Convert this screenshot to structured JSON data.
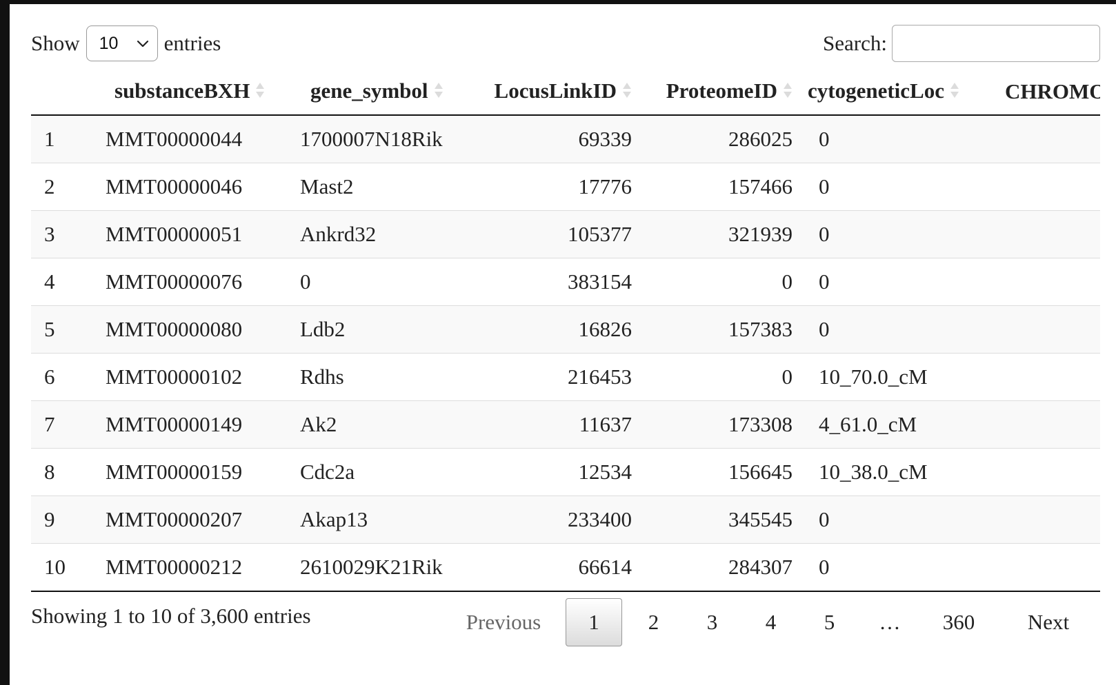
{
  "controls": {
    "show_label": "Show",
    "entries_label": "entries",
    "page_length_value": "10",
    "search_label": "Search:",
    "search_value": ""
  },
  "table": {
    "columns": [
      "",
      "substanceBXH",
      "gene_symbol",
      "LocusLinkID",
      "ProteomeID",
      "cytogeneticLoc",
      "CHROMO"
    ],
    "rows": [
      [
        "1",
        "MMT00000044",
        "1700007N18Rik",
        "69339",
        "286025",
        "0"
      ],
      [
        "2",
        "MMT00000046",
        "Mast2",
        "17776",
        "157466",
        "0"
      ],
      [
        "3",
        "MMT00000051",
        "Ankrd32",
        "105377",
        "321939",
        "0"
      ],
      [
        "4",
        "MMT00000076",
        "0",
        "383154",
        "0",
        "0"
      ],
      [
        "5",
        "MMT00000080",
        "Ldb2",
        "16826",
        "157383",
        "0"
      ],
      [
        "6",
        "MMT00000102",
        "Rdhs",
        "216453",
        "0",
        "10_70.0_cM"
      ],
      [
        "7",
        "MMT00000149",
        "Ak2",
        "11637",
        "173308",
        "4_61.0_cM"
      ],
      [
        "8",
        "MMT00000159",
        "Cdc2a",
        "12534",
        "156645",
        "10_38.0_cM"
      ],
      [
        "9",
        "MMT00000207",
        "Akap13",
        "233400",
        "345545",
        "0"
      ],
      [
        "10",
        "MMT00000212",
        "2610029K21Rik",
        "66614",
        "284307",
        "0"
      ]
    ]
  },
  "footer": {
    "info": "Showing 1 to 10 of 3,600 entries",
    "pagination": {
      "previous": "Previous",
      "current": "1",
      "pages": [
        "2",
        "3",
        "4",
        "5"
      ],
      "ellipsis": "…",
      "last": "360",
      "next": "Next"
    }
  },
  "colors": {
    "window_border": "#111111",
    "row_stripe": "#f9f9f9",
    "header_rule": "#111111",
    "row_rule": "#dddddd",
    "disabled_text": "#666666"
  }
}
